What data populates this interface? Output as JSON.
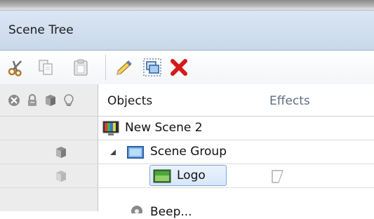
{
  "panel": {
    "title": "Scene Tree"
  },
  "toolbar": {
    "buttons": [
      {
        "icon": "scissors-icon",
        "label": "Cut"
      },
      {
        "icon": "copy-icon",
        "label": "Copy"
      },
      {
        "icon": "paste-icon",
        "label": "Paste"
      },
      {
        "icon": "pencil-icon",
        "label": "Rename"
      },
      {
        "icon": "group-icon",
        "label": "Group"
      },
      {
        "icon": "delete-x-icon",
        "label": "Delete"
      }
    ]
  },
  "columns": {
    "objects": "Objects",
    "effects": "Effects"
  },
  "header_icons": [
    "disable-icon",
    "lock-icon",
    "visibility-cube-icon",
    "lightbulb-icon"
  ],
  "tree": [
    {
      "label": "New Scene 2",
      "icon": "scene-icon"
    },
    {
      "label": "Scene Group",
      "icon": "group-folder-icon",
      "expanded": true
    },
    {
      "label": "Logo",
      "icon": "image-icon",
      "selected": true
    },
    {
      "label": "Beep...",
      "icon": "gear-icon"
    }
  ],
  "colors": {
    "title_bar": "#c9d8ea",
    "gutter": "#ececec",
    "selection_border": "#7fa7d6",
    "delete_red": "#d41a1a"
  }
}
